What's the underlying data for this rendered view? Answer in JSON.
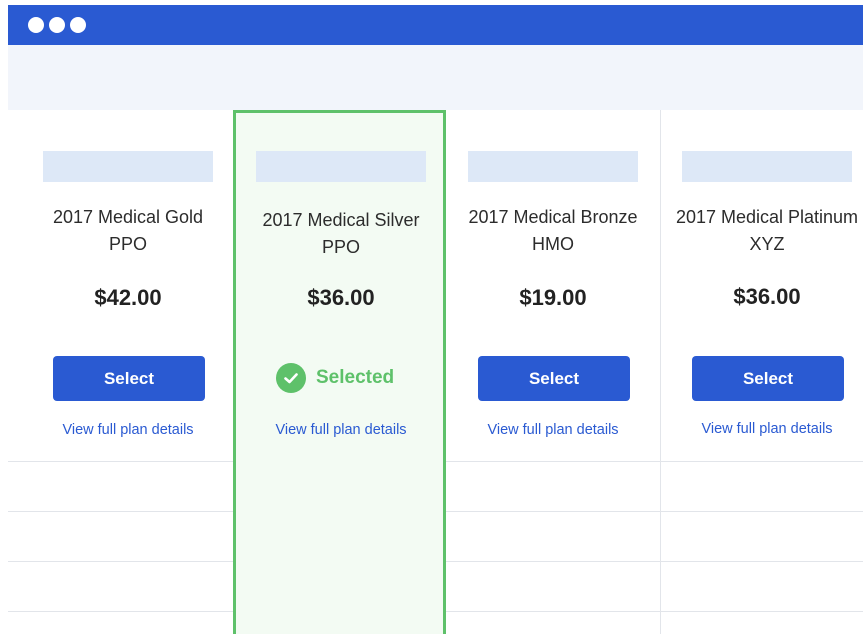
{
  "plans": [
    {
      "name": "2017 Medical Gold PPO",
      "price": "$42.00",
      "action_label": "Select",
      "details_link": "View full plan details",
      "selected": false
    },
    {
      "name": "2017 Medical Silver PPO",
      "price": "$36.00",
      "action_label": "Selected",
      "details_link": "View full plan details",
      "selected": true
    },
    {
      "name": "2017 Medical Bronze HMO",
      "price": "$19.00",
      "action_label": "Select",
      "details_link": "View full plan details",
      "selected": false
    },
    {
      "name": "2017 Medical Platinum XYZ",
      "price": "$36.00",
      "action_label": "Select",
      "details_link": "View full plan details",
      "selected": false
    }
  ],
  "colors": {
    "titlebar": "#2a5ad2",
    "accent": "#2a5ad2",
    "selected": "#5ec16a",
    "placeholder": "#dde8f7"
  },
  "icons": {
    "window_controls": "dots-icon",
    "selected_check": "check-circle-icon"
  }
}
